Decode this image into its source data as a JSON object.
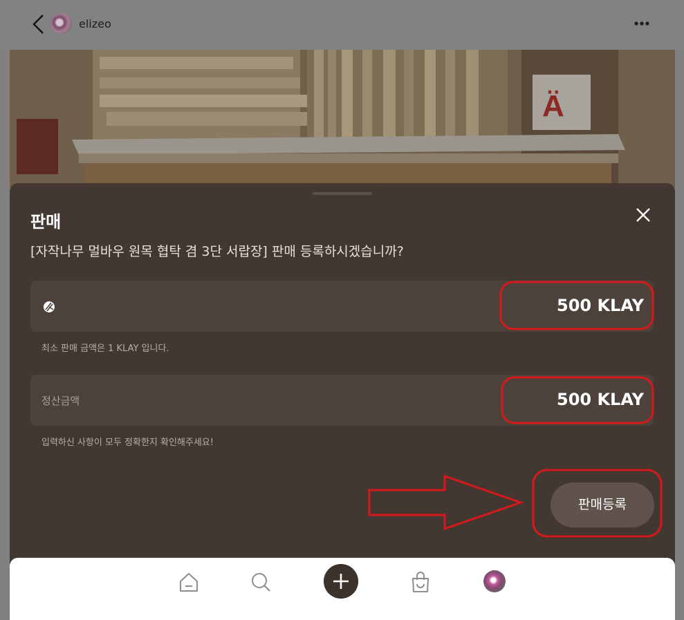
{
  "header": {
    "username": "elizeo",
    "back_icon": "chevron-left-icon",
    "more_icon": "more-horizontal-icon"
  },
  "sheet": {
    "title": "판매",
    "question": "[자작나무 멀바우 원목 협탁 겸 3단 서랍장] 판매 등록하시겠습니까?",
    "price_field": {
      "icon": "klay-icon",
      "value": "500 KLAY",
      "hint": "최소 판매 금액은 1 KLAY 입니다."
    },
    "settlement_field": {
      "label": "정산금액",
      "value": "500 KLAY",
      "hint": "입력하신 사항이 모두 정확한지 확인해주세요!"
    },
    "submit_label": "판매등록"
  },
  "bottom_nav": {
    "items": [
      "home-icon",
      "search-icon",
      "add-icon",
      "shopping-bag-icon",
      "profile-avatar"
    ]
  },
  "colors": {
    "sheet_bg": "#433831",
    "field_bg": "#4d423b",
    "button_bg": "#5f534c",
    "annotation_red": "#d7191c"
  }
}
